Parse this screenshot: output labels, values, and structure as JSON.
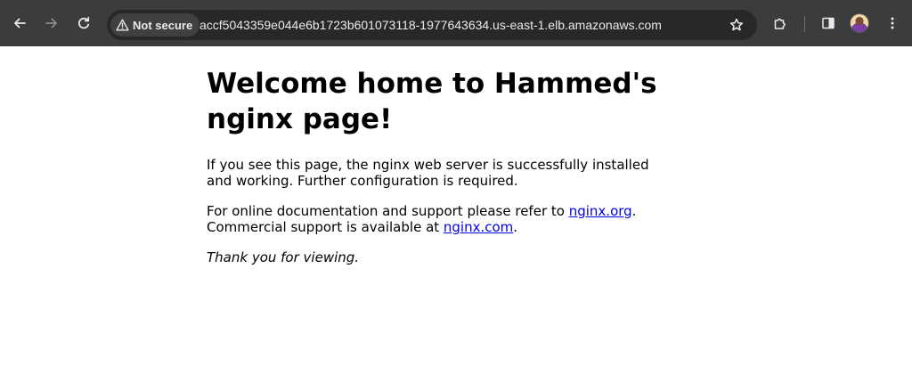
{
  "browser": {
    "security_label": "Not secure",
    "url": "accf5043359e044e6b1723b601073118-1977643634.us-east-1.elb.amazonaws.com",
    "icons": {
      "back": "arrow-left-icon",
      "forward": "arrow-right-icon",
      "reload": "reload-icon",
      "security": "warning-triangle-icon",
      "bookmark": "star-icon",
      "extensions": "puzzle-icon",
      "side_panel": "side-panel-icon",
      "profile": "avatar",
      "menu": "kebab-menu-icon"
    },
    "colors": {
      "toolbar": "#3c3c3c",
      "omnibox": "#282828",
      "chip": "#404040",
      "text": "#e8eaed"
    }
  },
  "page": {
    "heading": "Welcome home to Hammed's nginx page!",
    "p1": "If you see this page, the nginx web server is successfully installed and working. Further configuration is required.",
    "p2_before": "For online documentation and support please refer to ",
    "link_org": "nginx.org",
    "p2_middle": ".\nCommercial support is available at ",
    "link_com": "nginx.com",
    "p2_after": ".",
    "p3": "Thank you for viewing.",
    "colors": {
      "link": "#0000ee",
      "text": "#000000",
      "background": "#ffffff"
    }
  }
}
